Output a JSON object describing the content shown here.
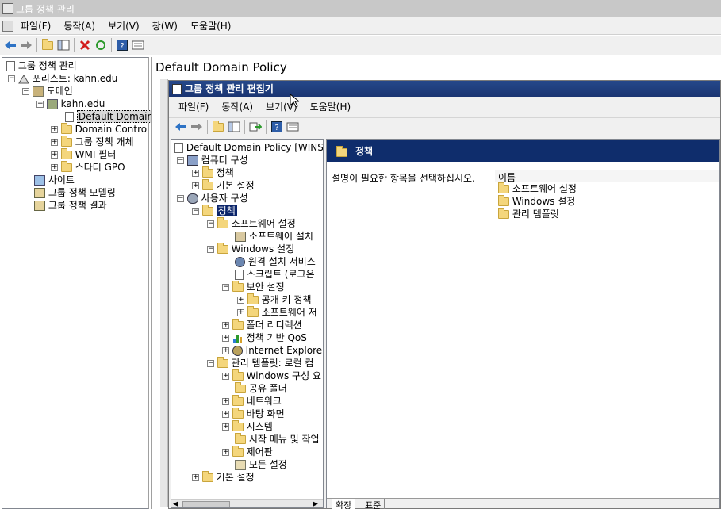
{
  "outer": {
    "title": "그룹 정책 관리",
    "menu": [
      "파일(F)",
      "동작(A)",
      "보기(V)",
      "창(W)",
      "도움말(H)"
    ],
    "tree": [
      {
        "text": "그룹 정책 관리",
        "icon": "gpm-icon"
      },
      {
        "text": "포리스트: kahn.edu",
        "icon": "forest-icon"
      },
      {
        "text": "도메인",
        "icon": "domains-icon"
      },
      {
        "text": "kahn.edu",
        "icon": "domain-icon"
      },
      {
        "text": "Default Domain",
        "icon": "gpo-link-icon"
      },
      {
        "text": "Domain Contro",
        "icon": "folder-icon"
      },
      {
        "text": "그룹 정책 개체",
        "icon": "folder-icon"
      },
      {
        "text": "WMI 필터",
        "icon": "folder-icon"
      },
      {
        "text": "스타터 GPO",
        "icon": "folder-icon"
      },
      {
        "text": "사이트",
        "icon": "sites-icon"
      },
      {
        "text": "그룹 정책 모델링",
        "icon": "modeling-icon"
      },
      {
        "text": "그룹 정책 결과",
        "icon": "results-icon"
      }
    ],
    "right_title": "Default Domain Policy"
  },
  "editor": {
    "title": "그룹 정책 관리 편집기",
    "menu": [
      "파일(F)",
      "동작(A)",
      "보기(V)",
      "도움말(H)"
    ],
    "tree": [
      {
        "text": "Default Domain Policy [WINS",
        "icon": "gpo-icon"
      },
      {
        "text": "컴퓨터 구성",
        "icon": "computer-config-icon"
      },
      {
        "text": "정책",
        "icon": "folder-icon"
      },
      {
        "text": "기본 설정",
        "icon": "folder-icon"
      },
      {
        "text": "사용자 구성",
        "icon": "user-config-icon"
      },
      {
        "text": "정책",
        "icon": "folder-icon"
      },
      {
        "text": "소프트웨어 설정",
        "icon": "folder-icon"
      },
      {
        "text": "소프트웨어 설치",
        "icon": "software-install-icon"
      },
      {
        "text": "Windows 설정",
        "icon": "folder-icon"
      },
      {
        "text": "원격 설치 서비스",
        "icon": "remote-install-icon"
      },
      {
        "text": "스크립트 (로그온",
        "icon": "script-icon"
      },
      {
        "text": "보안 설정",
        "icon": "security-folder-icon"
      },
      {
        "text": "공개 키 정책",
        "icon": "folder-icon"
      },
      {
        "text": "소프트웨어 저",
        "icon": "folder-icon"
      },
      {
        "text": "폴더 리디렉션",
        "icon": "folder-redirect-icon"
      },
      {
        "text": "정책 기반 QoS",
        "icon": "qos-chart-icon"
      },
      {
        "text": "Internet Explorer",
        "icon": "ie-maintenance-icon"
      },
      {
        "text": "관리 템플릿: 로컬 컴",
        "icon": "folder-icon"
      },
      {
        "text": "Windows 구성 요",
        "icon": "folder-icon"
      },
      {
        "text": "공유 폴더",
        "icon": "folder-icon"
      },
      {
        "text": "네트워크",
        "icon": "folder-icon"
      },
      {
        "text": "바탕 화면",
        "icon": "folder-icon"
      },
      {
        "text": "시스템",
        "icon": "folder-icon"
      },
      {
        "text": "시작 메뉴 및 작업",
        "icon": "folder-icon"
      },
      {
        "text": "제어판",
        "icon": "folder-icon"
      },
      {
        "text": "모든 설정",
        "icon": "all-settings-icon"
      },
      {
        "text": "기본 설정",
        "icon": "folder-icon"
      }
    ],
    "header_title": "정책",
    "description": "설명이 필요한 항목을 선택하십시오.",
    "column_name": "이름",
    "items": [
      "소프트웨어 설정",
      "Windows 설정",
      "관리 템플릿"
    ],
    "tabs": [
      "확장",
      "표준"
    ]
  },
  "colors": {
    "selection": "#0a246a",
    "header_bg": "#0f2d6c",
    "title_bg": "#1a3572",
    "folder": "#f4d67c"
  }
}
